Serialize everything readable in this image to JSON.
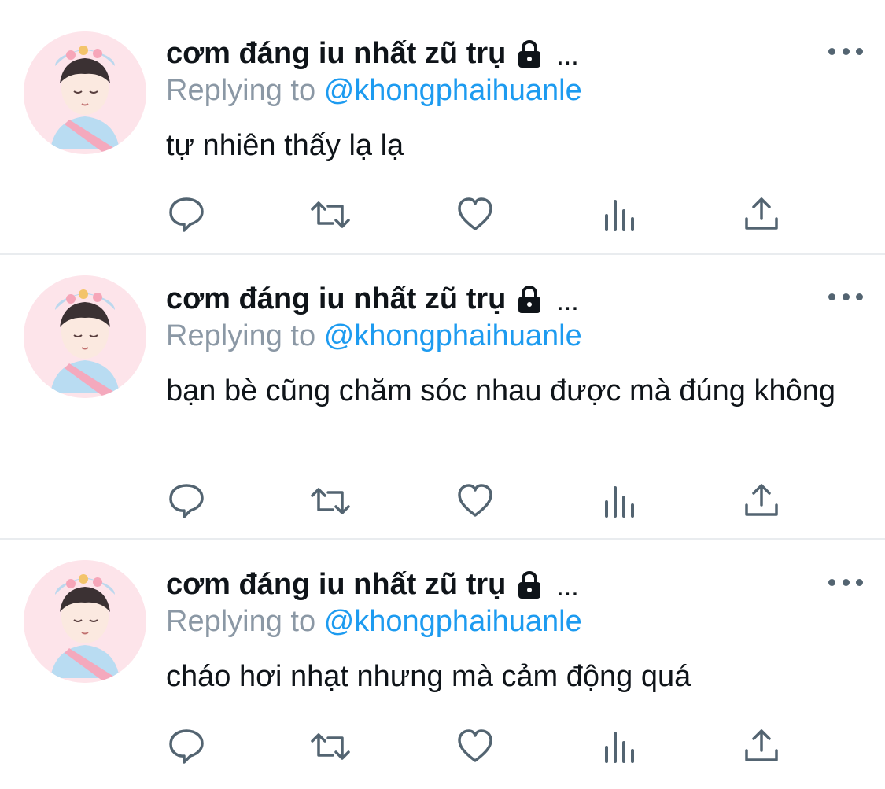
{
  "tweets": [
    {
      "display_name": "cơm đáng iu nhất zũ trụ",
      "name_overflow": "...",
      "reply_prefix": "Replying to",
      "reply_handle": "@khongphaihuanle",
      "text": "tự nhiên thấy lạ lạ"
    },
    {
      "display_name": "cơm đáng iu nhất zũ trụ",
      "name_overflow": "...",
      "reply_prefix": "Replying to",
      "reply_handle": "@khongphaihuanle",
      "text": "bạn bè cũng chăm sóc nhau được mà đúng không"
    },
    {
      "display_name": "cơm đáng iu nhất zũ trụ",
      "name_overflow": "...",
      "reply_prefix": "Replying to",
      "reply_handle": "@khongphaihuanle",
      "text": "cháo hơi nhạt nhưng mà cảm động quá"
    }
  ],
  "icons": {
    "reply": "reply-icon",
    "retweet": "retweet-icon",
    "like": "heart-icon",
    "analytics": "analytics-icon",
    "share": "share-icon",
    "protected": "lock-icon",
    "more": "more-icon"
  },
  "colors": {
    "name": "#0f1419",
    "secondary": "#8b98a5",
    "link": "#1d9bf0",
    "icon": "#536471",
    "divider": "#e9ecef"
  }
}
